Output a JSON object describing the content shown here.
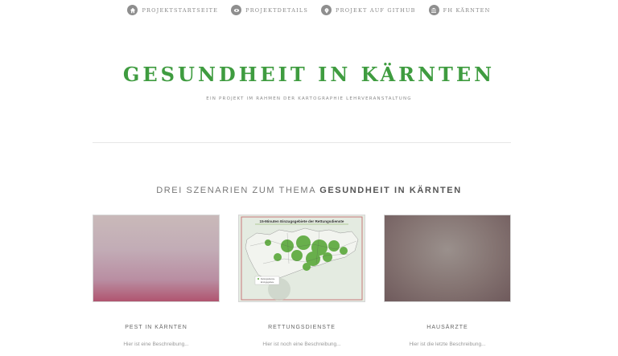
{
  "nav": {
    "items": [
      {
        "label": "Projektstartseite",
        "icon": "home-icon"
      },
      {
        "label": "Projektdetails",
        "icon": "eye-icon"
      },
      {
        "label": "Projekt auf GitHub",
        "icon": "github-icon"
      },
      {
        "label": "FH Kärnten",
        "icon": "institution-icon"
      }
    ]
  },
  "header": {
    "title": "GESUNDHEIT IN KÄRNTEN",
    "subtitle": "Ein Projekt im Rahmen der Kartographie Lehrveranstaltung"
  },
  "section": {
    "heading_prefix": "DREI SZENARIEN ZUM THEMA",
    "heading_strong": "GESUNDHEIT IN KÄRNTEN"
  },
  "cards": [
    {
      "title": "Pest in Kärnten",
      "description": "Hier ist eine Beschreibung..."
    },
    {
      "title": "Rettungsdienste",
      "description": "Hier ist noch eine Beschreibung...",
      "map_title": "15-Minuten Einzugsgebiete der Rettungsdienste",
      "map_legend": [
        "Rettungsdienste",
        "Einzugsgebiete"
      ]
    },
    {
      "title": "Hausärzte",
      "description": "Hier ist die letzte Beschreibung..."
    }
  ],
  "colors": {
    "accent": "#3f9c40",
    "icon": "#8e8e8e"
  }
}
